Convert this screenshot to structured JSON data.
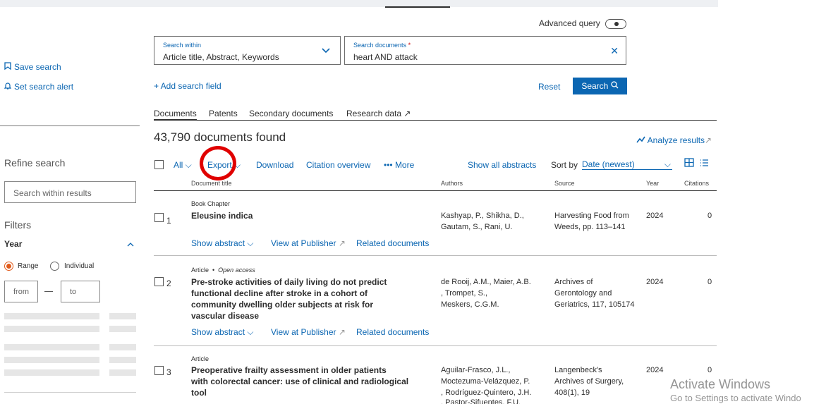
{
  "header": {
    "advanced_query_label": "Advanced query"
  },
  "search": {
    "within_label": "Search within",
    "within_value": "Article title, Abstract, Keywords",
    "documents_label": "Search documents",
    "documents_required_mark": "*",
    "documents_value": "heart AND attack",
    "add_field_label": "+ Add search field",
    "reset_label": "Reset",
    "search_button_label": "Search",
    "search_icon": "magnifier-icon"
  },
  "sidebar": {
    "save_search": "Save search",
    "set_alert": "Set search alert",
    "refine_title": "Refine search",
    "search_within_placeholder": "Search within results",
    "filters_title": "Filters",
    "year_label": "Year",
    "range_label": "Range",
    "individual_label": "Individual",
    "from_placeholder": "from",
    "to_placeholder": "to"
  },
  "tabs": [
    {
      "label": "Documents",
      "active": true
    },
    {
      "label": "Patents"
    },
    {
      "label": "Secondary documents"
    },
    {
      "label": "Research data ↗"
    }
  ],
  "results": {
    "count_text": "43,790 documents found",
    "analyze_label": "Analyze results",
    "analyze_icon": "trend-line-icon",
    "toolbar": {
      "all": "All",
      "export": "Export",
      "download": "Download",
      "citation_overview": "Citation overview",
      "more": "••• More",
      "show_all_abstracts": "Show all abstracts",
      "sort_by": "Sort by",
      "sort_value": "Date (newest)"
    },
    "columns": {
      "document_title": "Document title",
      "authors": "Authors",
      "source": "Source",
      "year": "Year",
      "citations": "Citations"
    },
    "rows": [
      {
        "num": "1",
        "doc_type": "Book Chapter",
        "open_access": "",
        "title_lines": [
          "Eleusine indica"
        ],
        "authors_lines": [
          "Kashyap, P., Shikha, D.,",
          "Gautam, S., Rani, U."
        ],
        "source_lines": [
          "Harvesting Food from",
          "Weeds, pp. 113–141"
        ],
        "year": "2024",
        "citations": "0"
      },
      {
        "num": "2",
        "doc_type": "Article",
        "open_access": "Open access",
        "title_lines": [
          "Pre-stroke activities of daily living do not predict",
          "functional decline after stroke in a cohort of",
          "community dwelling older subjects at risk for",
          "vascular disease"
        ],
        "authors_lines": [
          "de Rooij, A.M., Maier, A.B.",
          ", Trompet, S.,",
          "Meskers, C.G.M."
        ],
        "source_lines": [
          "Archives of",
          "Gerontology and",
          "Geriatrics, 117, 105174"
        ],
        "year": "2024",
        "citations": "0"
      },
      {
        "num": "3",
        "doc_type": "Article",
        "open_access": "",
        "title_lines": [
          "Preoperative frailty assessment in older patients",
          "with colorectal cancer: use of clinical and radiological",
          "tool"
        ],
        "authors_lines": [
          "Aguilar-Frasco, J.L.,",
          "Moctezuma-Velázquez, P.",
          ", Rodríguez-Quintero, J.H.",
          ", Pastor-Sifuentes, F.U."
        ],
        "source_lines": [
          "Langenbeck's",
          "Archives of Surgery,",
          "408(1), 19"
        ],
        "year": "2024",
        "citations": "0"
      }
    ],
    "row_links": {
      "show_abstract": "Show abstract",
      "view_at_publisher": "View at Publisher",
      "related_documents": "Related documents"
    }
  },
  "watermark": {
    "line1": "Activate Windows",
    "line2": "Go to Settings to activate Windo"
  },
  "colors": {
    "link_blue": "#0b66b2",
    "annotation_red": "#e00000",
    "radio_orange": "#e05a1a"
  }
}
